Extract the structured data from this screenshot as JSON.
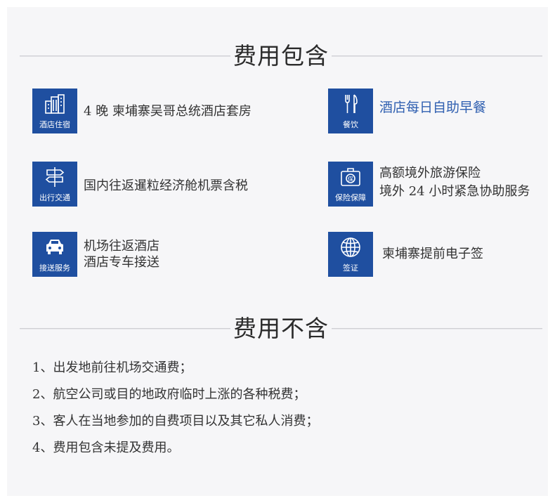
{
  "included": {
    "title": "费用包含",
    "items": [
      {
        "icon": "hotel-icon",
        "caption": "酒店住宿",
        "lines": [
          "4 晚  柬埔寨吴哥总统酒店套房"
        ]
      },
      {
        "icon": "dining-icon",
        "caption": "餐饮",
        "lines": [
          "酒店每日自助早餐"
        ]
      },
      {
        "icon": "signpost-icon",
        "caption": "出行交通",
        "lines": [
          "国内往返暹粒经济舱机票含税"
        ]
      },
      {
        "icon": "insurance-icon",
        "caption": "保险保障",
        "lines": [
          "高额境外旅游保险",
          "境外 24 小时紧急协助服务"
        ]
      },
      {
        "icon": "car-icon",
        "caption": "接送服务",
        "lines": [
          "机场往返酒店",
          "酒店专车接送"
        ]
      },
      {
        "icon": "globe-icon",
        "caption": "签证",
        "lines": [
          "柬埔寨提前电子签"
        ]
      }
    ]
  },
  "excluded": {
    "title": "费用不含",
    "items": [
      "1、出发地前往机场交通费；",
      "2、航空公司或目的地政府临时上涨的各种税费；",
      "3、客人在当地参加的自费项目以及其它私人消费；",
      "4、费用包含未提及费用。"
    ]
  },
  "colors": {
    "icon_bg": "#1f4fa0",
    "accent_text": "#2f5fb0",
    "panel_bg": "#f6f6f8"
  }
}
